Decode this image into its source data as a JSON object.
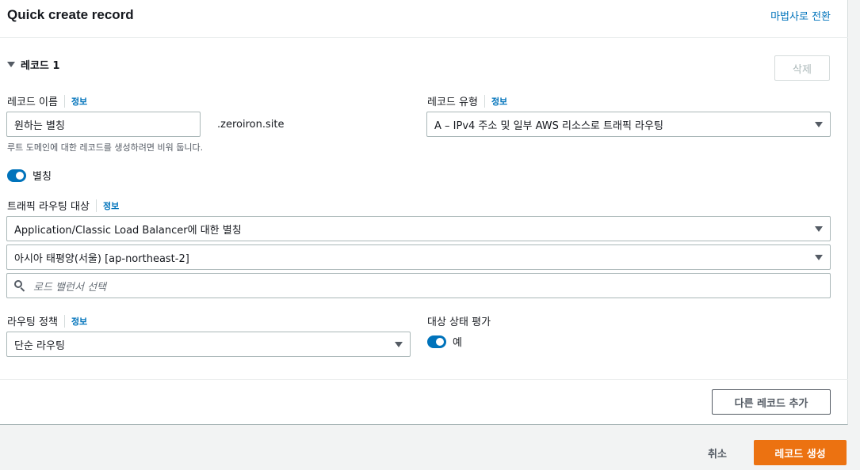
{
  "header": {
    "title": "Quick create record",
    "wizard_link": "마법사로 전환"
  },
  "record": {
    "section_title": "레코드 1",
    "delete_label": "삭제",
    "name_label": "레코드 이름",
    "info": "정보",
    "name_value": "원하는 별칭",
    "domain_suffix": ".zeroiron.site",
    "name_hint": "루트 도메인에 대한 레코드를 생성하려면 비워 둡니다.",
    "type_label": "레코드 유형",
    "type_value": "A – IPv4 주소 및 일부 AWS 리소스로 트래픽 라우팅",
    "alias_label": "별칭",
    "target_label": "트래픽 라우팅 대상",
    "target_type": "Application/Classic Load Balancer에 대한 별칭",
    "region": "아시아 태평양(서울) [ap-northeast-2]",
    "lb_placeholder": "로드 밸런서 선택",
    "policy_label": "라우팅 정책",
    "policy_value": "단순 라우팅",
    "health_label": "대상 상태 평가",
    "health_value": "예"
  },
  "footer": {
    "add_record": "다른 레코드 추가",
    "cancel": "취소",
    "create": "레코드 생성"
  },
  "colors": {
    "accent": "#0073bb",
    "primary_button": "#ec7211"
  },
  "icons": [
    "caret-down-icon",
    "dropdown-arrow-icon",
    "search-icon",
    "toggle-switch-icon"
  ]
}
